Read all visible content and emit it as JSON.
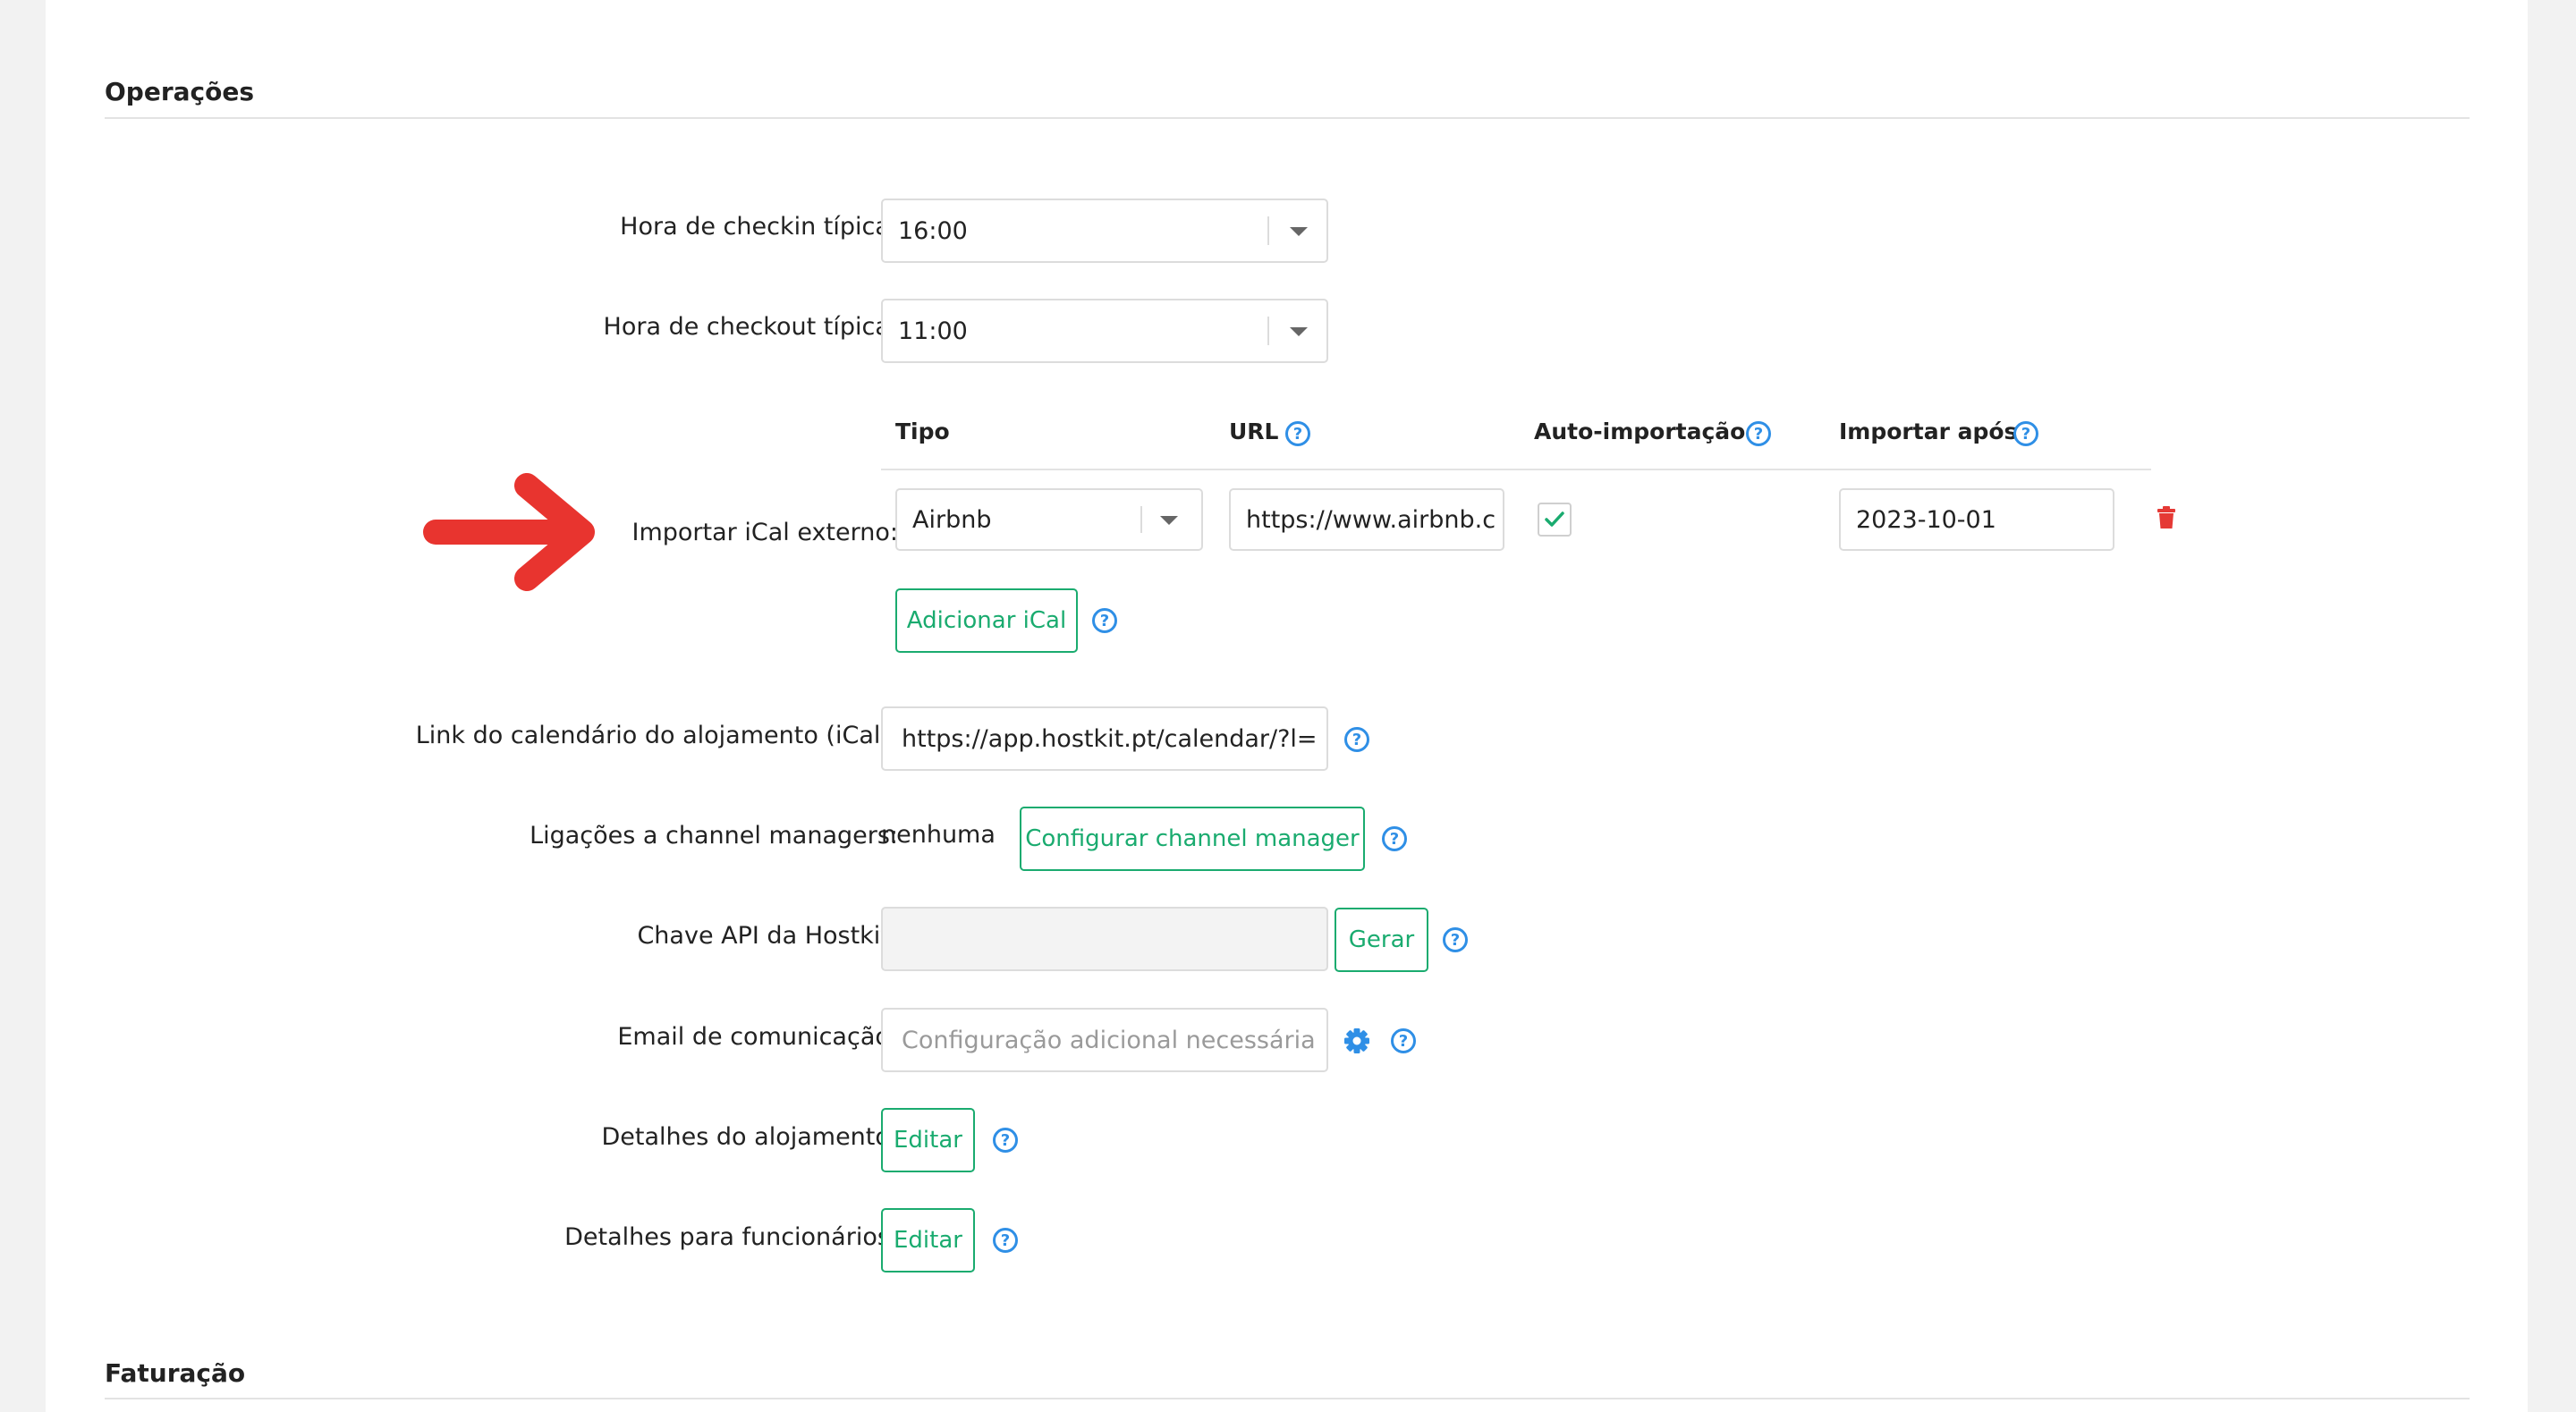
{
  "sections": {
    "operations_title": "Operações",
    "billing_title": "Faturação"
  },
  "checkin": {
    "label": "Hora de checkin típica:",
    "value": "16:00"
  },
  "checkout": {
    "label": "Hora de checkout típica:",
    "value": "11:00"
  },
  "ical_import": {
    "label": "Importar iCal externo:",
    "headers": {
      "type": "Tipo",
      "url": "URL",
      "auto_import": "Auto-importação",
      "import_after": "Importar após"
    },
    "rows": [
      {
        "type": "Airbnb",
        "url": "https://www.airbnb.c",
        "auto_import": true,
        "import_after": "2023-10-01"
      }
    ],
    "add_button": "Adicionar iCal"
  },
  "calendar_link": {
    "label": "Link do calendário do alojamento (iCal):",
    "value": "https://app.hostkit.pt/calendar/?l="
  },
  "channel_managers": {
    "label": "Ligações a channel managers:",
    "value": "nenhuma",
    "button": "Configurar channel manager"
  },
  "api_key": {
    "label": "Chave API da Hostkit:",
    "value": "",
    "button": "Gerar"
  },
  "email": {
    "label": "Email de comunicação:",
    "placeholder": "Configuração adicional necessária"
  },
  "lodging_details": {
    "label": "Detalhes do alojamento:",
    "button": "Editar"
  },
  "staff_details": {
    "label": "Detalhes para funcionários:",
    "button": "Editar"
  },
  "icons": {
    "help": "question-circle-icon",
    "settings": "gear-icon",
    "delete": "trash-icon",
    "annotation": "red-arrow-right-icon"
  },
  "colors": {
    "accent": "#1aab6f",
    "help": "#2f8fe6",
    "danger": "#e53935",
    "arrow": "#e8342f"
  }
}
